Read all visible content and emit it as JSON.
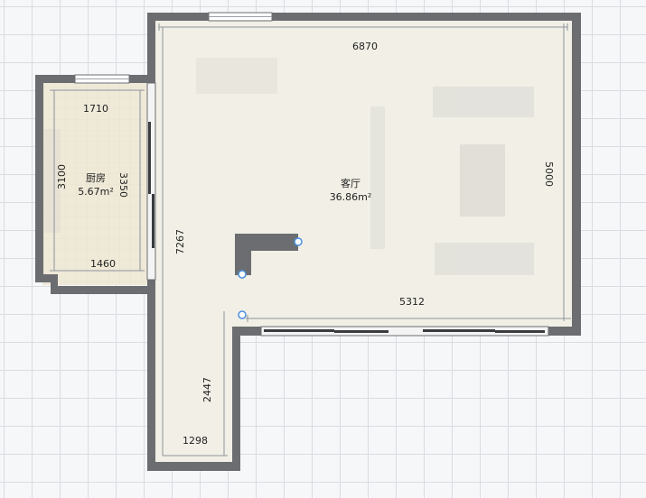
{
  "rooms": [
    {
      "name": "厨房",
      "area": "5.67m²"
    },
    {
      "name": "客厅",
      "area": "36.86m²"
    }
  ],
  "dimensions": {
    "living_top": "6870",
    "living_right": "5000",
    "living_bottom": "5312",
    "living_left": "7267",
    "kitchen_top": "1710",
    "kitchen_left": "3100",
    "kitchen_right": "3350",
    "kitchen_bottom": "1460",
    "corridor_right": "2447",
    "corridor_bottom": "1298"
  },
  "colors": {
    "wall": "#6b6d70",
    "floor_living": "#f1efe6",
    "floor_kitchen": "#efe9d8",
    "dim_line": "#8e949b",
    "handle": "#4a90e2"
  }
}
